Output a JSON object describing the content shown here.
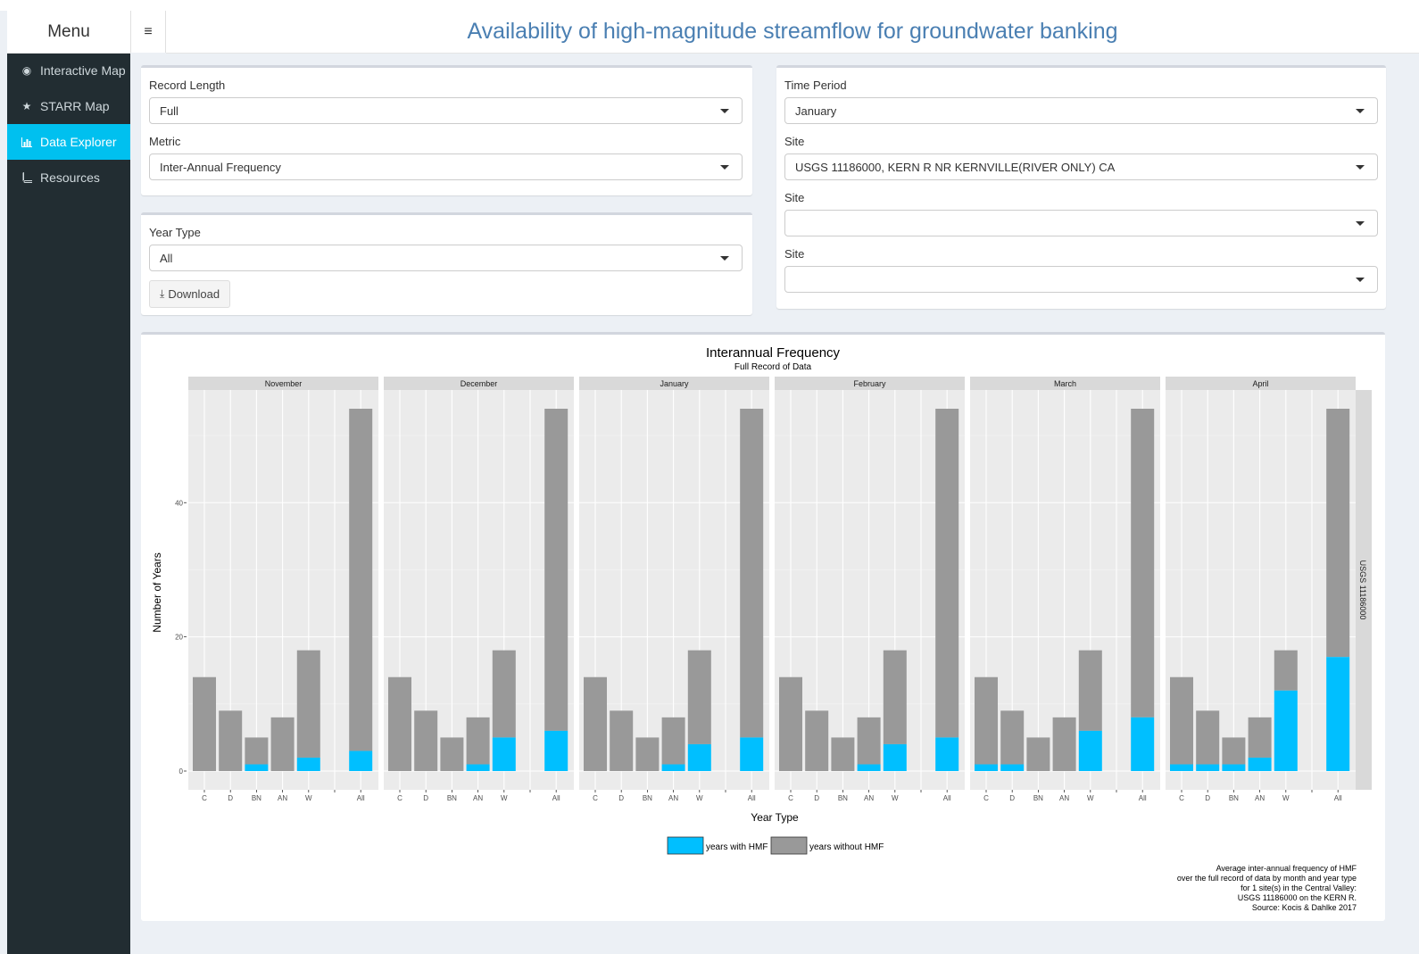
{
  "sidebar": {
    "menu_label": "Menu",
    "items": [
      {
        "label": "Interactive Map",
        "icon": "globe-icon"
      },
      {
        "label": "STARR Map",
        "icon": "star-icon"
      },
      {
        "label": "Data Explorer",
        "icon": "bar-chart-icon",
        "active": true
      },
      {
        "label": "Resources",
        "icon": "book-icon"
      }
    ]
  },
  "header": {
    "toggle_icon": "hamburger-icon",
    "title": "Availability of high-magnitude streamflow for groundwater banking"
  },
  "filters": {
    "record_length": {
      "label": "Record Length",
      "value": "Full"
    },
    "metric": {
      "label": "Metric",
      "value": "Inter-Annual Frequency"
    },
    "year_type": {
      "label": "Year Type",
      "value": "All"
    },
    "download": {
      "label": "Download",
      "icon": "download-icon"
    },
    "time_period": {
      "label": "Time Period",
      "value": "January"
    },
    "site1": {
      "label": "Site",
      "value": "USGS 11186000, KERN R NR KERNVILLE(RIVER ONLY) CA"
    },
    "site2": {
      "label": "Site",
      "value": ""
    },
    "site3": {
      "label": "Site",
      "value": ""
    }
  },
  "colors": {
    "accent": "#00c0ef",
    "sidebar_bg": "#222d32",
    "title_blue": "#4a7fb2",
    "with_hmf": "#00bfff",
    "without_hmf": "#999999",
    "panel_bg": "#ebebeb",
    "strip_bg": "#d9d9d9"
  },
  "chart_data": {
    "type": "bar",
    "title": "Interannual Frequency",
    "subtitle": "Full Record of Data",
    "xlabel": "Year Type",
    "ylabel": "Number of Years",
    "ylim": [
      0,
      56
    ],
    "yticks": [
      0,
      20,
      40
    ],
    "grid": true,
    "stacked": true,
    "facet_label_right": "USGS 11186000",
    "categories": [
      "C",
      "D",
      "BN",
      "AN",
      "W",
      "All"
    ],
    "legend": {
      "position": "bottom",
      "entries": [
        "years with HMF",
        "years without HMF"
      ]
    },
    "totals": [
      14,
      9,
      5,
      8,
      18,
      54
    ],
    "facets": [
      {
        "name": "November",
        "with_hmf": [
          0,
          0,
          1,
          0,
          2,
          3
        ]
      },
      {
        "name": "December",
        "with_hmf": [
          0,
          0,
          0,
          1,
          5,
          6
        ]
      },
      {
        "name": "January",
        "with_hmf": [
          0,
          0,
          0,
          1,
          4,
          5
        ]
      },
      {
        "name": "February",
        "with_hmf": [
          0,
          0,
          0,
          1,
          4,
          5
        ]
      },
      {
        "name": "March",
        "with_hmf": [
          1,
          1,
          0,
          0,
          6,
          8
        ]
      },
      {
        "name": "April",
        "with_hmf": [
          1,
          1,
          1,
          2,
          12,
          17
        ]
      }
    ],
    "caption": [
      "Average inter-annual frequency of HMF",
      "over the full record of data by month and year type",
      "for 1 site(s) in the Central Valley:",
      "USGS 11186000 on the KERN R.",
      "Source: Kocis & Dahlke 2017"
    ]
  }
}
